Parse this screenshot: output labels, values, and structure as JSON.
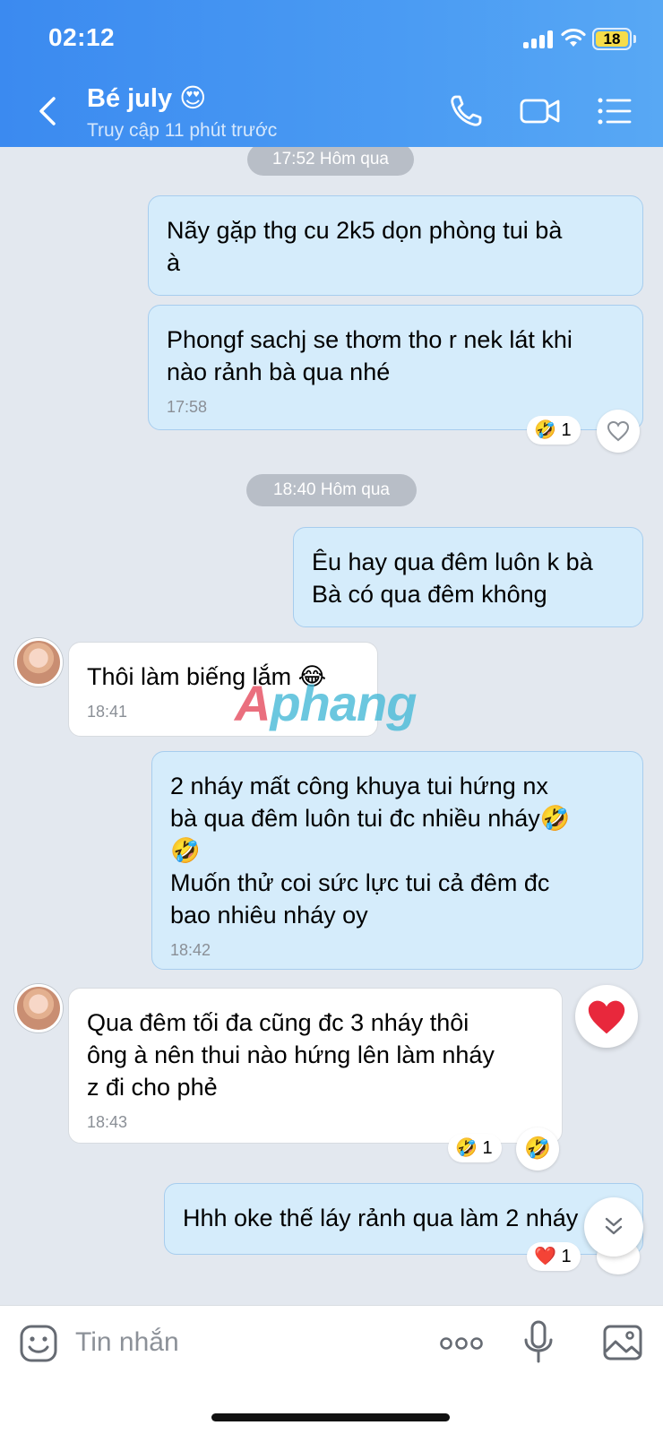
{
  "status_bar": {
    "time": "02:12",
    "battery": "18"
  },
  "header": {
    "contact_name": "Bé july 😍",
    "last_seen": "Truy cập 11 phút trước",
    "icons": [
      "back-chevron-icon",
      "phone-icon",
      "video-camera-icon",
      "menu-list-icon"
    ]
  },
  "chat": {
    "time_separators": [
      "17:52 Hôm qua",
      "18:40 Hôm qua"
    ],
    "messages": [
      {
        "direction": "out",
        "text": "Nãy gặp thg cu 2k5 dọn phòng tui bà\nà",
        "time": ""
      },
      {
        "direction": "out",
        "text": "Phongf sachj se thơm tho r nek lát khi\nnào rảnh bà qua nhé",
        "time": "17:58",
        "reaction": "🤣",
        "reaction_count": "1"
      },
      {
        "direction": "out",
        "text": "Êu hay qua đêm luôn k bà\nBà có qua đêm không",
        "time": ""
      },
      {
        "direction": "in",
        "text": "Thôi làm biếng lắm 😂",
        "time": "18:41"
      },
      {
        "direction": "out",
        "text": "2 nháy mất công khuya tui hứng nx\nbà qua đêm luôn tui đc nhiều nháy🤣\n🤣\nMuốn thử coi sức lực tui cả đêm đc\nbao nhiêu nháy oy",
        "time": "18:42"
      },
      {
        "direction": "in",
        "text": "Qua đêm tối đa cũng đc 3 nháy thôi\nông à nên thui nào hứng lên làm nháy\nz đi cho phẻ",
        "time": "18:43",
        "reaction": "🤣",
        "reaction_count": "1",
        "my_reaction": "🤣"
      },
      {
        "direction": "out",
        "text": "Hhh oke thế láy rảnh qua làm 2 nháy",
        "time": "",
        "reaction": "❤️",
        "reaction_count": "1"
      }
    ],
    "big_reaction": "❤️",
    "watermark": {
      "part1": "A",
      "part2": "phang"
    }
  },
  "composer": {
    "placeholder": "Tin nhắn",
    "icons": [
      "sticker-icon",
      "more-dots-icon",
      "microphone-icon",
      "image-gallery-icon"
    ]
  }
}
